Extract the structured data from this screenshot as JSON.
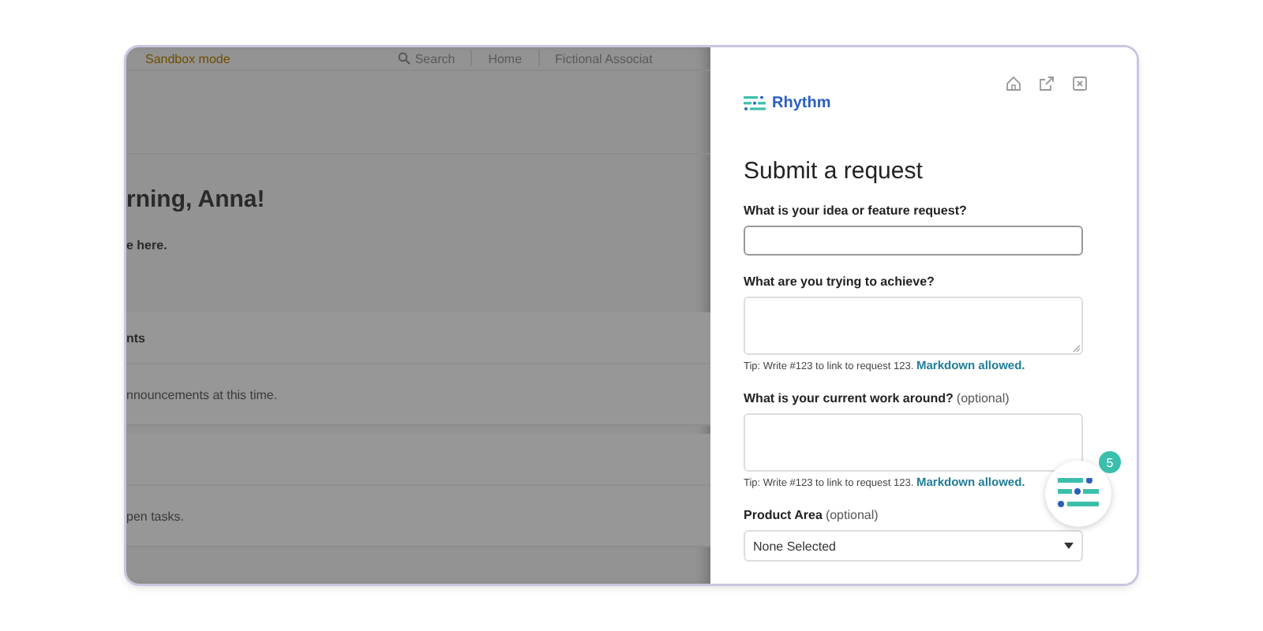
{
  "background_page": {
    "header": {
      "mode_label": "Sandbox mode",
      "search_label": "Search",
      "nav_label": "Home",
      "org_label": "Fictional Associat"
    },
    "greeting": "rning, Anna!",
    "subtitle": "e here.",
    "sections": [
      {
        "heading": "nts",
        "message": "nnouncements at this time."
      },
      {
        "message": "pen tasks."
      }
    ]
  },
  "panel": {
    "brand": "Rhythm",
    "title": "Submit a request",
    "fields": [
      {
        "kind": "input",
        "label": "What is your idea or feature request?"
      },
      {
        "kind": "textarea",
        "label": "What are you trying to achieve?",
        "tip": "Tip: Write #123 to link to request 123.",
        "tip_link": "Markdown allowed."
      },
      {
        "kind": "textarea",
        "label": "What is your current work around?",
        "note": "(optional)",
        "tip": "Tip: Write #123 to link to request 123.",
        "tip_link": "Markdown allowed."
      },
      {
        "kind": "select",
        "label": "Product Area",
        "note": "(optional)",
        "value": "None Selected"
      }
    ]
  },
  "widget": {
    "badge": "5"
  }
}
